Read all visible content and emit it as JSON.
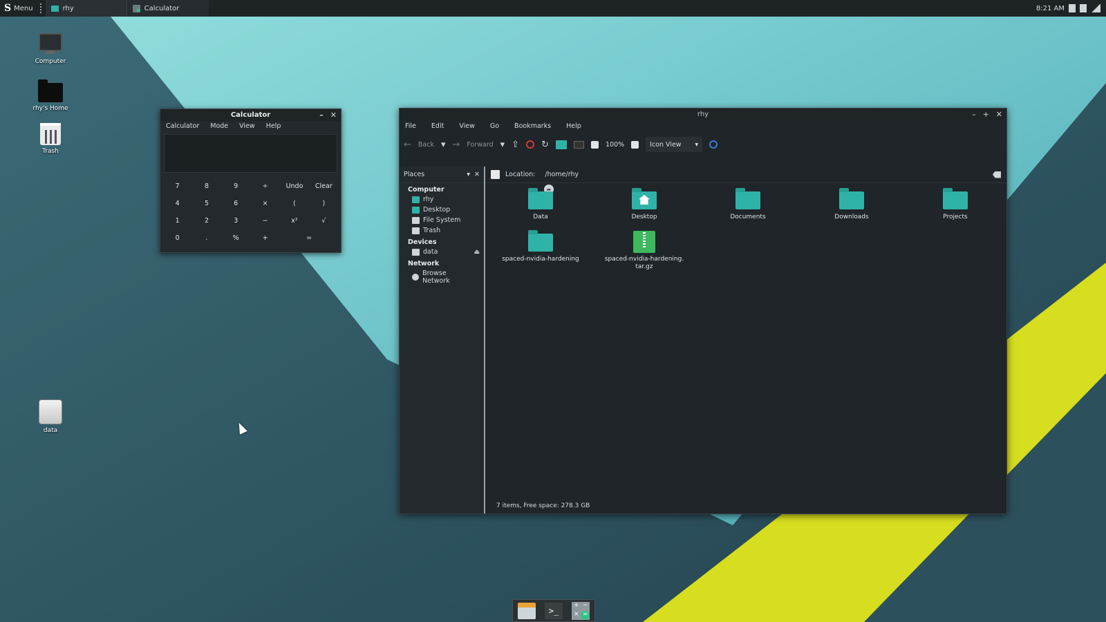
{
  "taskbar": {
    "menu_logo": "S",
    "menu_label": "Menu",
    "tasks": [
      {
        "label": "rhy"
      },
      {
        "label": "Calculator"
      }
    ],
    "clock": "8:21 AM"
  },
  "desktop_icons": [
    {
      "label": "Computer"
    },
    {
      "label": "rhy's Home"
    },
    {
      "label": "Trash"
    },
    {
      "label": "data"
    }
  ],
  "calculator": {
    "title": "Calculator",
    "menu": [
      "Calculator",
      "Mode",
      "View",
      "Help"
    ],
    "display_value": "",
    "buttons": [
      "7",
      "8",
      "9",
      "÷",
      "Undo",
      "Clear",
      "4",
      "5",
      "6",
      "×",
      "(",
      ")",
      "1",
      "2",
      "3",
      "−",
      "x²",
      "√",
      "0",
      ".",
      "%",
      "+",
      "="
    ]
  },
  "file_manager": {
    "title": "rhy",
    "menu": [
      "File",
      "Edit",
      "View",
      "Go",
      "Bookmarks",
      "Help"
    ],
    "toolbar": {
      "back": "Back",
      "forward": "Forward",
      "zoom": "100%",
      "view_mode": "Icon View"
    },
    "sidebar": {
      "header": "Places",
      "sections": [
        {
          "title": "Computer",
          "items": [
            "rhy",
            "Desktop",
            "File System",
            "Trash"
          ]
        },
        {
          "title": "Devices",
          "items": [
            "data"
          ]
        },
        {
          "title": "Network",
          "items": [
            "Browse Network"
          ]
        }
      ]
    },
    "location_label": "Location:",
    "location_path": "/home/rhy",
    "items": [
      {
        "label": "Data",
        "type": "folder-link"
      },
      {
        "label": "Desktop",
        "type": "folder-home"
      },
      {
        "label": "Documents",
        "type": "folder"
      },
      {
        "label": "Downloads",
        "type": "folder"
      },
      {
        "label": "Projects",
        "type": "folder"
      },
      {
        "label": "spaced-nvidia-hardening",
        "type": "folder"
      },
      {
        "label": "spaced-nvidia-hardening.\ntar.gz",
        "type": "archive"
      }
    ],
    "status": "7 items, Free space: 278.3 GB"
  },
  "colors": {
    "accent": "#2fb3a8",
    "taskbar": "#1e2326",
    "window_bg": "#1f2528",
    "wallpaper_yellow": "#d9e021"
  }
}
